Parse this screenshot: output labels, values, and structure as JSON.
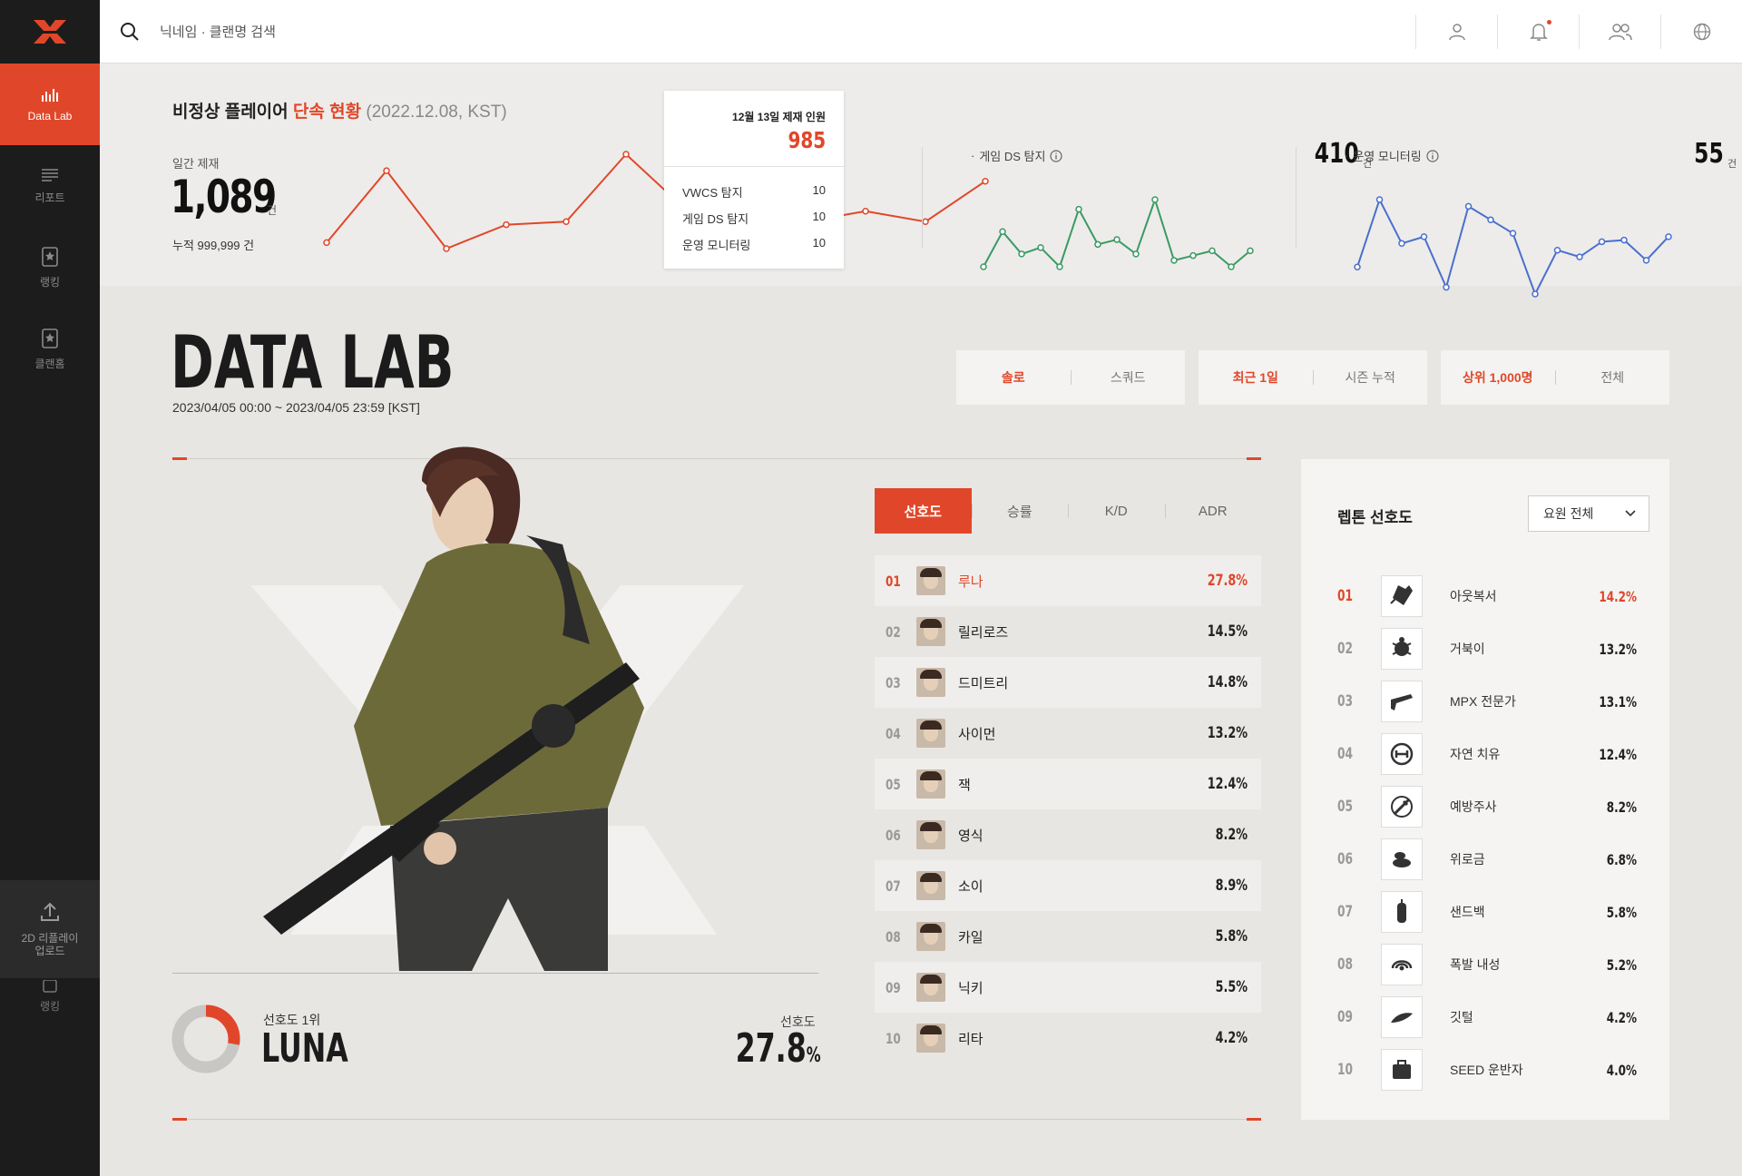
{
  "sidebar": {
    "items": [
      {
        "label": "Data Lab",
        "icon": "chart-icon"
      },
      {
        "label": "리포트",
        "icon": "list-icon"
      },
      {
        "label": "랭킹",
        "icon": "badge-icon"
      },
      {
        "label": "클랜홈",
        "icon": "clan-icon"
      }
    ],
    "upload_label_line1": "2D 리플레이",
    "upload_label_line2": "업로드",
    "ghost_label": "랭킹"
  },
  "topbar": {
    "search_placeholder": "닉네임 · 클랜명 검색"
  },
  "stats": {
    "title_prefix": "비정상 플레이어 ",
    "title_highlight": "단속 현황",
    "title_date": " (2022.12.08, KST)",
    "daily_label": "일간 제재",
    "daily_value": "1,089",
    "daily_unit": "건",
    "cumulative": "누적 999,999 건",
    "daily_series": [
      62,
      110,
      58,
      74,
      76,
      121,
      84,
      76,
      76,
      83,
      76,
      103
    ],
    "tooltip": {
      "title": "12월 13일 제재 인원",
      "value": "985",
      "rows": [
        {
          "label": "VWCS 탐지",
          "value": "10"
        },
        {
          "label": "게임 DS 탐지",
          "value": "10"
        },
        {
          "label": "운영 모니터링",
          "value": "10"
        }
      ]
    },
    "ds": {
      "label": "게임 DS 탐지",
      "value": "410",
      "unit": "건",
      "color": "#3a9a63",
      "series": [
        30,
        52,
        38,
        42,
        30,
        66,
        44,
        47,
        38,
        72,
        34,
        37,
        40,
        30,
        40
      ]
    },
    "monitor": {
      "label": "운영 모니터링",
      "value": "55",
      "unit": "건",
      "color": "#4a6fce",
      "series": [
        50,
        90,
        64,
        68,
        38,
        86,
        78,
        70,
        34,
        60,
        56,
        65,
        66,
        54,
        68
      ]
    }
  },
  "datalab": {
    "title": "DATA LAB",
    "date_range": "2023/04/05 00:00 ~ 2023/04/05 23:59 [KST]",
    "mode_filter": [
      {
        "label": "솔로",
        "active": true
      },
      {
        "label": "스쿼드",
        "active": false
      }
    ],
    "period_filter": [
      {
        "label": "최근 1일",
        "active": true
      },
      {
        "label": "시즌 누적",
        "active": false
      }
    ],
    "rank_filter": [
      {
        "label": "상위 1,000명",
        "active": true
      },
      {
        "label": "전체",
        "active": false
      }
    ]
  },
  "featured": {
    "rank_label": "선호도 1위",
    "name": "LUNA",
    "pct_label": "선호도",
    "pct_value": "27.8",
    "pct_unit": "%",
    "pct_number": 27.8
  },
  "tabs": [
    {
      "label": "선호도",
      "active": true
    },
    {
      "label": "승률",
      "active": false
    },
    {
      "label": "K/D",
      "active": false
    },
    {
      "label": "ADR",
      "active": false
    }
  ],
  "ranking": [
    {
      "rank": "01",
      "name": "루나",
      "pct": "27.8%"
    },
    {
      "rank": "02",
      "name": "릴리로즈",
      "pct": "14.5%"
    },
    {
      "rank": "03",
      "name": "드미트리",
      "pct": "14.8%"
    },
    {
      "rank": "04",
      "name": "사이먼",
      "pct": "13.2%"
    },
    {
      "rank": "05",
      "name": "잭",
      "pct": "12.4%"
    },
    {
      "rank": "06",
      "name": "영식",
      "pct": "8.2%"
    },
    {
      "rank": "07",
      "name": "소이",
      "pct": "8.9%"
    },
    {
      "rank": "08",
      "name": "카일",
      "pct": "5.8%"
    },
    {
      "rank": "09",
      "name": "닉키",
      "pct": "5.5%"
    },
    {
      "rank": "10",
      "name": "리타",
      "pct": "4.2%"
    }
  ],
  "perks": {
    "title": "렙톤 선호도",
    "select_value": "요원 전체",
    "items": [
      {
        "rank": "01",
        "name": "아웃복서",
        "pct": "14.2%",
        "icon": "glove-icon"
      },
      {
        "rank": "02",
        "name": "거북이",
        "pct": "13.2%",
        "icon": "turtle-icon"
      },
      {
        "rank": "03",
        "name": "MPX 전문가",
        "pct": "13.1%",
        "icon": "gun-icon"
      },
      {
        "rank": "04",
        "name": "자연 치유",
        "pct": "12.4%",
        "icon": "heal-icon"
      },
      {
        "rank": "05",
        "name": "예방주사",
        "pct": "8.2%",
        "icon": "syringe-icon"
      },
      {
        "rank": "06",
        "name": "위로금",
        "pct": "6.8%",
        "icon": "coin-icon"
      },
      {
        "rank": "07",
        "name": "샌드백",
        "pct": "5.8%",
        "icon": "sandbag-icon"
      },
      {
        "rank": "08",
        "name": "폭발 내성",
        "pct": "5.2%",
        "icon": "blast-icon"
      },
      {
        "rank": "09",
        "name": "깃털",
        "pct": "4.2%",
        "icon": "feather-icon"
      },
      {
        "rank": "10",
        "name": "SEED 운반자",
        "pct": "4.0%",
        "icon": "bag-icon"
      }
    ]
  },
  "colors": {
    "accent": "#e0472a",
    "sidebar": "#1c1c1c",
    "ds_line": "#3a9a63",
    "monitor_line": "#4a6fce"
  }
}
